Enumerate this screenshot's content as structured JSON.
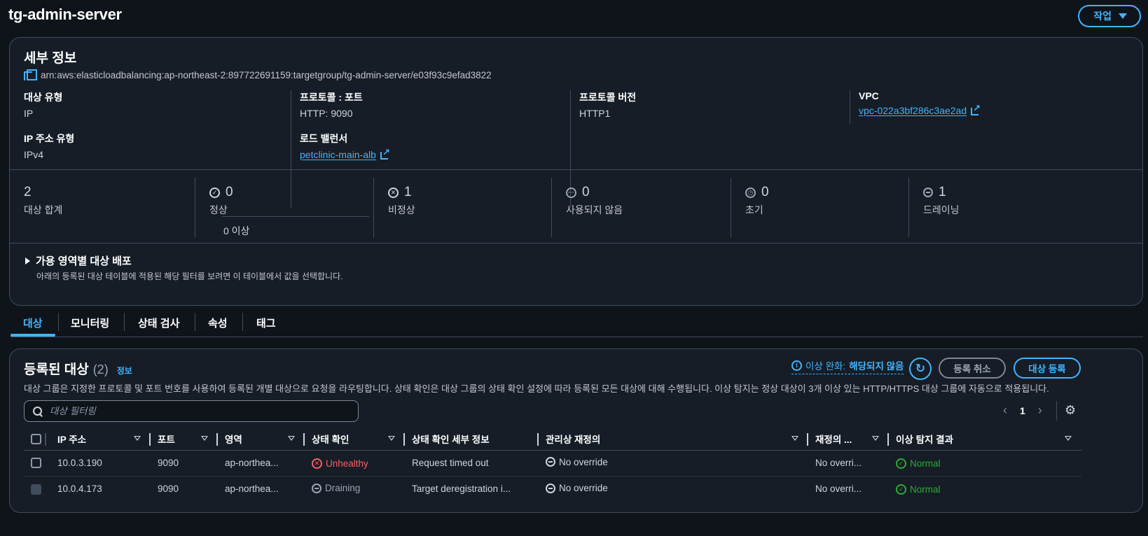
{
  "page": {
    "title": "tg-admin-server",
    "action_label": "작업"
  },
  "details": {
    "title": "세부 정보",
    "arn": "arn:aws:elasticloadbalancing:ap-northeast-2:897722691159:targetgroup/tg-admin-server/e03f93c9efad3822",
    "target_type_key": "대상 유형",
    "target_type_val": "IP",
    "ip_type_key": "IP 주소 유형",
    "ip_type_val": "IPv4",
    "protocol_port_key": "프로토콜 : 포트",
    "protocol_port_val": "HTTP: 9090",
    "load_balancer_key": "로드 밸런서",
    "load_balancer_val": "petclinic-main-alb",
    "protocol_version_key": "프로토콜 버전",
    "protocol_version_val": "HTTP1",
    "vpc_key": "VPC",
    "vpc_val": "vpc-022a3bf286c3ae2ad"
  },
  "stats": {
    "total_num": "2",
    "total_label": "대상 합계",
    "healthy_num": "0",
    "healthy_label": "정상",
    "anomalous_text": "0 이상",
    "unhealthy_num": "1",
    "unhealthy_label": "비정상",
    "unused_num": "0",
    "unused_label": "사용되지 않음",
    "initial_num": "0",
    "initial_label": "초기",
    "draining_num": "1",
    "draining_label": "드레이닝"
  },
  "az": {
    "title": "가용 영역별 대상 배포",
    "description": "아래의 등록된 대상 테이블에 적용된 해당 필터를 보려면 이 테이블에서 값을 선택합니다."
  },
  "tabs": [
    "대상",
    "모니터링",
    "상태 검사",
    "속성",
    "태그"
  ],
  "targets": {
    "title": "등록된 대상",
    "count": "(2)",
    "info_label": "정보",
    "description": "대상 그룹은 지정한 프로토콜 및 포트 번호를 사용하여 등록된 개별 대상으로 요청을 라우팅합니다. 상태 확인은 대상 그룹의 상태 확인 설정에 따라 등록된 모든 대상에 대해 수행됩니다. 이상 탐지는 정상 대상이 3개 이상 있는 HTTP/HTTPS 대상 그룹에 자동으로 적용됩니다.",
    "anomaly_mitigation_label": "이상 완화:",
    "anomaly_mitigation_value": "해당되지 않음",
    "deregister_label": "등록 취소",
    "register_label": "대상 등록",
    "filter_placeholder": "대상 필터링",
    "page_number": "1",
    "columns": [
      "IP 주소",
      "포트",
      "영역",
      "상태 확인",
      "상태 확인 세부 정보",
      "관리상 재정의",
      "재정의 ...",
      "이상 탐지 결과"
    ],
    "rows": [
      {
        "ip": "10.0.3.190",
        "port": "9090",
        "zone": "ap-northea...",
        "health": "Unhealthy",
        "details": "Request timed out",
        "override": "No override",
        "override_reason": "No overri...",
        "anomaly": "Normal"
      },
      {
        "ip": "10.0.4.173",
        "port": "9090",
        "zone": "ap-northea...",
        "health": "Draining",
        "details": "Target deregistration i...",
        "override": "No override",
        "override_reason": "No overri...",
        "anomaly": "Normal"
      }
    ]
  },
  "colors": {
    "accent": "#42b4ff",
    "healthy": "#29ad32",
    "unhealthy": "#ff5d64",
    "background": "#0f141a",
    "panel": "#161d26"
  }
}
